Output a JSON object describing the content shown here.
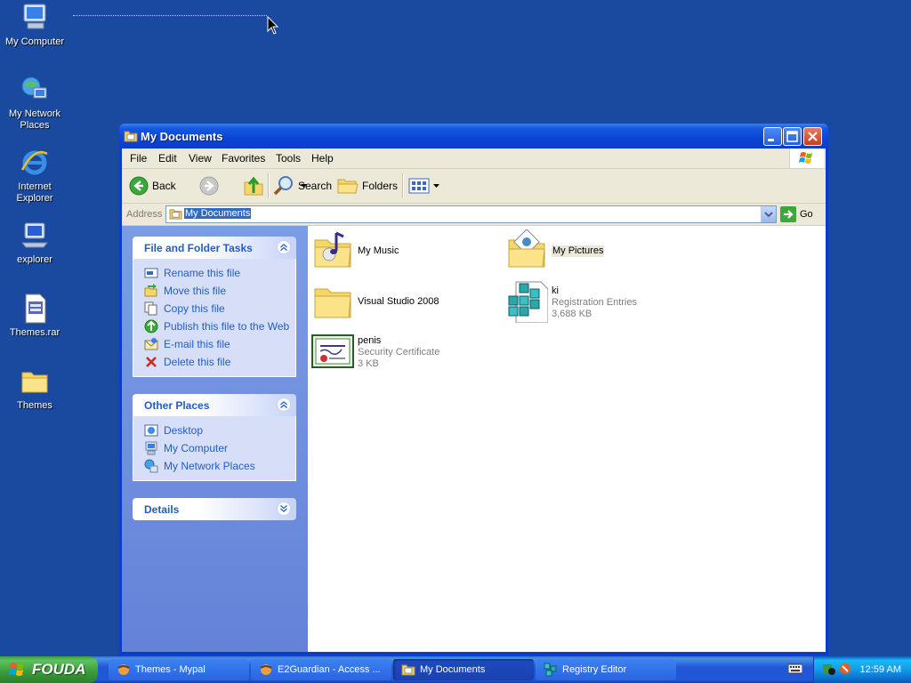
{
  "desktop": {
    "icons": [
      {
        "label_line1": "My Computer",
        "label_line2": ""
      },
      {
        "label_line1": "My Network",
        "label_line2": "Places"
      },
      {
        "label_line1": "Internet",
        "label_line2": "Explorer"
      },
      {
        "label_line1": "explorer",
        "label_line2": ""
      },
      {
        "label_line1": "Themes.rar",
        "label_line2": ""
      },
      {
        "label_line1": "Themes",
        "label_line2": ""
      }
    ]
  },
  "window": {
    "title": "My Documents",
    "menu": [
      "File",
      "Edit",
      "View",
      "Favorites",
      "Tools",
      "Help"
    ],
    "toolbar": {
      "back": "Back",
      "search": "Search",
      "folders": "Folders"
    },
    "address": {
      "label": "Address",
      "value": "My Documents",
      "go": "Go"
    },
    "file_tasks": {
      "title": "File and Folder Tasks",
      "items": [
        "Rename this file",
        "Move this file",
        "Copy this file",
        "Publish this file to the Web",
        "E-mail this file",
        "Delete this file"
      ]
    },
    "other_places": {
      "title": "Other Places",
      "items": [
        "Desktop",
        "My Computer",
        "My Network Places"
      ]
    },
    "details": {
      "title": "Details"
    },
    "files": [
      {
        "name": "My Music",
        "type": "",
        "size": ""
      },
      {
        "name": "My Pictures",
        "type": "",
        "size": ""
      },
      {
        "name": "Visual Studio 2008",
        "type": "",
        "size": ""
      },
      {
        "name": "ki",
        "type": "Registration Entries",
        "size": "3,688 KB"
      },
      {
        "name": "penis",
        "type": "Security Certificate",
        "size": "3 KB"
      }
    ]
  },
  "taskbar": {
    "start": "FOUDA",
    "tasks": [
      "Themes - Mypal",
      "E2Guardian - Access ...",
      "My Documents",
      "Registry Editor"
    ],
    "clock": "12:59 AM"
  },
  "colors": {
    "desktop_bg": "#1a4aa0",
    "titlebar": "#0a3ec8",
    "task_link": "#215dc6",
    "start_green": "#3a9a3a"
  }
}
